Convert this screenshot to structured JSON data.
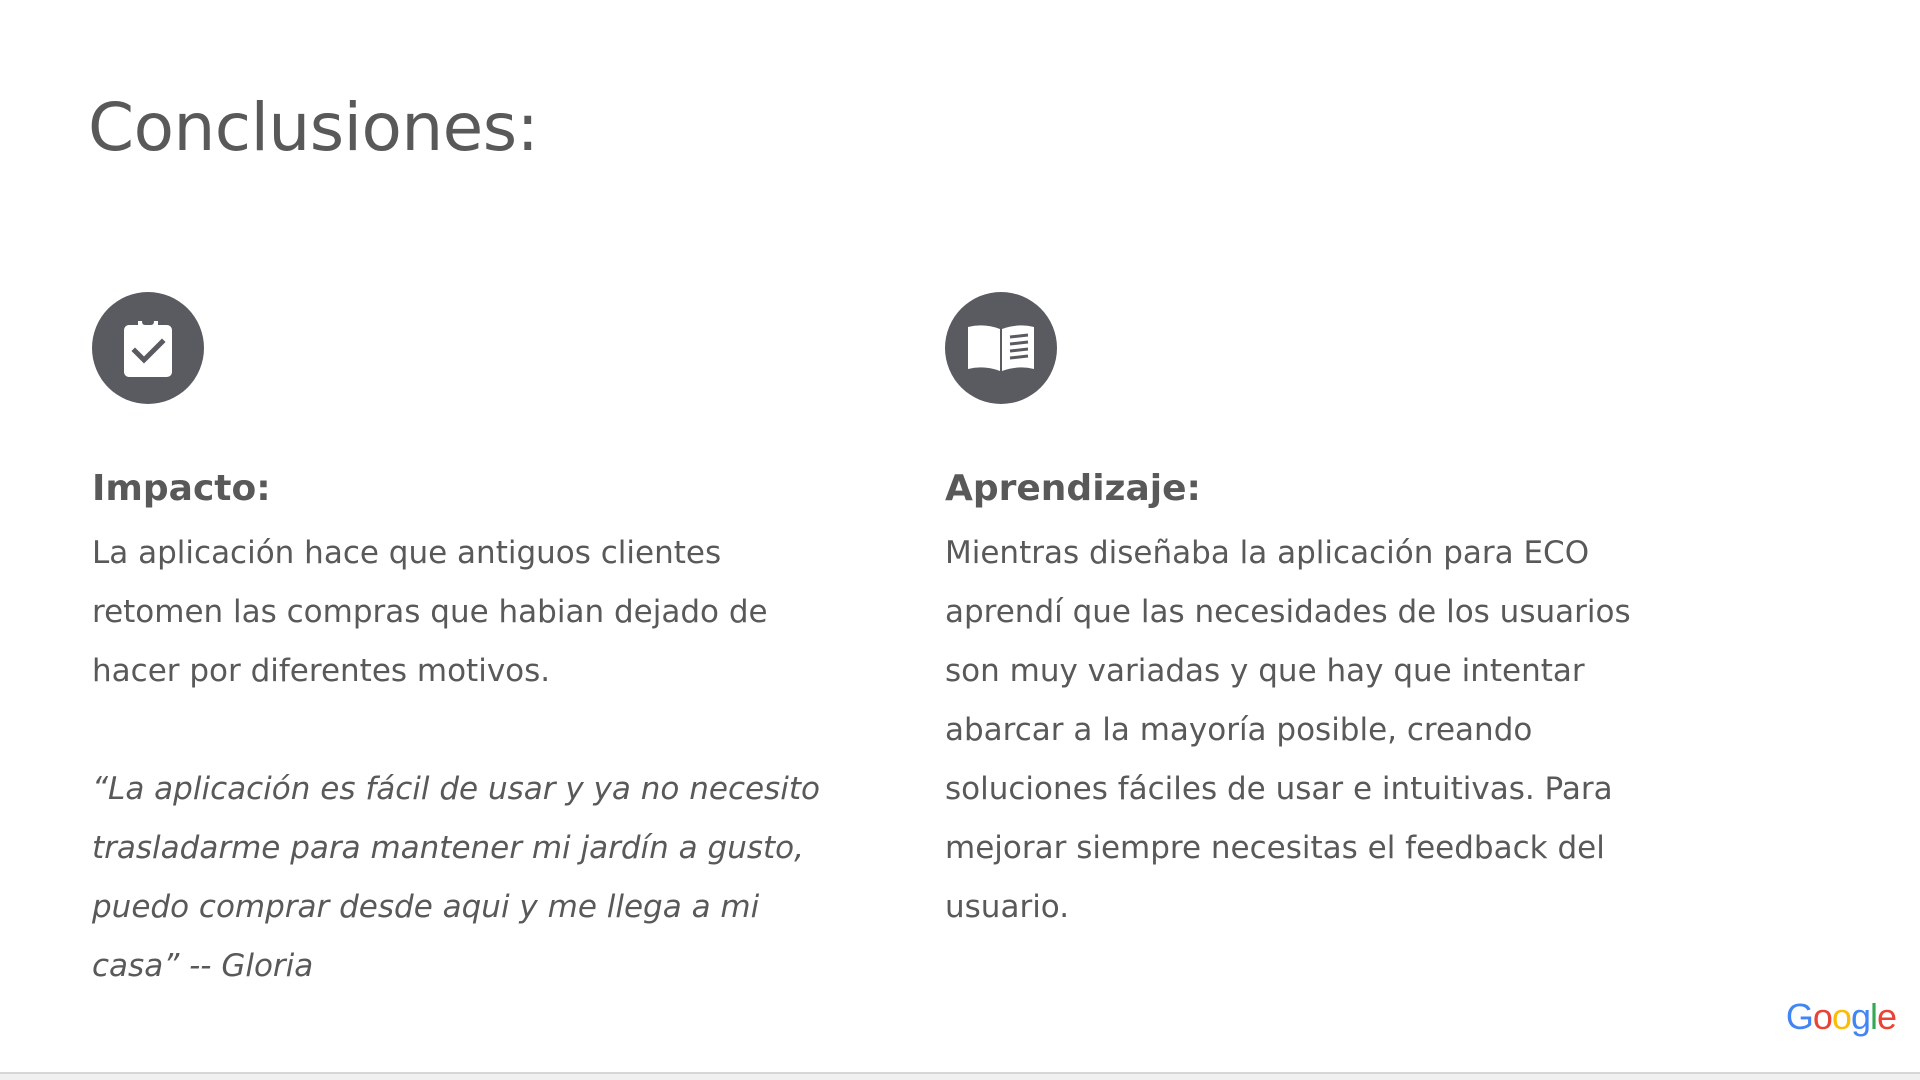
{
  "slide": {
    "title": "Conclusiones:"
  },
  "columns": [
    {
      "icon": "clipboard-check-icon",
      "heading": "Impacto:",
      "body": "La aplicación hace que antiguos clientes retomen las compras que habian dejado de hacer por diferentes motivos.",
      "quote": "“La aplicación es fácil de usar y ya no necesito trasladarme para mantener mi jardín a gusto, puedo comprar desde aqui y me llega a mi casa” -- Gloria"
    },
    {
      "icon": "open-book-icon",
      "heading": "Aprendizaje:",
      "body": "Mientras diseñaba la aplicación para ECO aprendí que las necesidades de los usuarios son muy variadas y que hay que intentar abarcar a la mayoría posible, creando soluciones fáciles de usar e intuitivas. Para mejorar siempre necesitas el feedback del usuario."
    }
  ],
  "branding": {
    "logo": [
      "G",
      "o",
      "o",
      "g",
      "l",
      "e"
    ]
  },
  "colors": {
    "text": "#595959",
    "icon_bg": "#595b61",
    "background": "#ffffff"
  }
}
